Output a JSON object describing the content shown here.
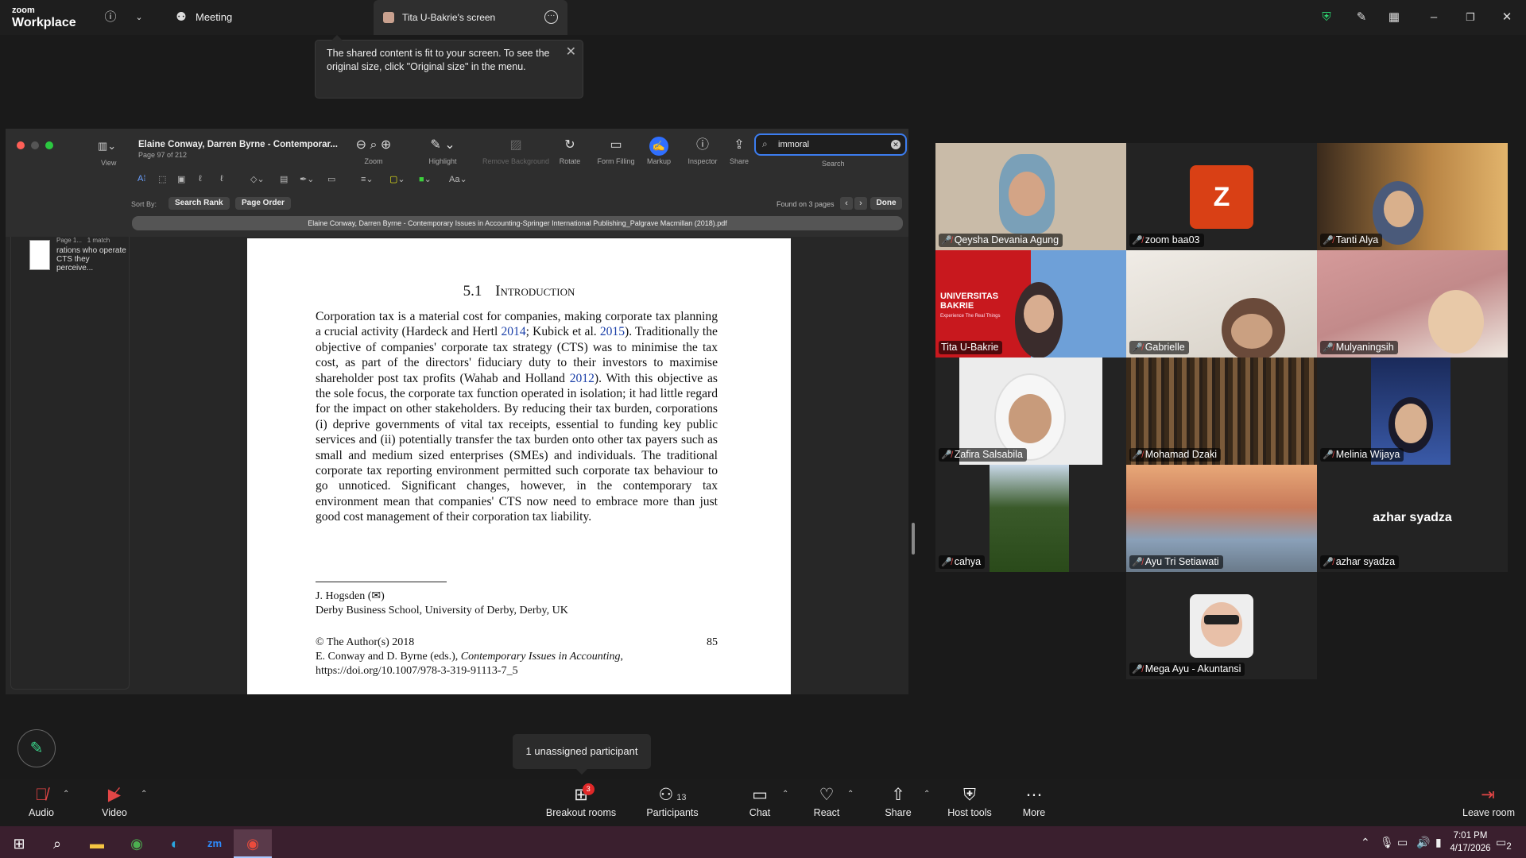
{
  "titlebar": {
    "brand_top": "zoom",
    "brand_bottom": "Workplace",
    "meeting_label": "Meeting",
    "share_tab_label": "Tita U-Bakrie's screen"
  },
  "tooltip": {
    "text": "The shared content is fit to your screen. To see the original size, click \"Original size\" in the menu."
  },
  "pdf": {
    "view_label": "View",
    "doc_title": "Elaine Conway, Darren Byrne - Contemporar...",
    "page_info": "Page 97 of 212",
    "tools": {
      "zoom": "Zoom",
      "highlight": "Highlight",
      "remove_background": "Remove Background",
      "rotate": "Rotate",
      "form_filling": "Form Filling",
      "markup": "Markup",
      "inspector": "Inspector",
      "share": "Share",
      "search": "Search"
    },
    "search_value": "immoral",
    "font_control": "Aa",
    "sort_by": "Sort By:",
    "sort_rank": "Search Rank",
    "sort_order": "Page Order",
    "found": "Found on 3 pages",
    "done": "Done",
    "filename": "Elaine Conway, Darren Byrne - Contemporary Issues in Accounting-Springer International Publishing_Palgrave Macmillan (2018).pdf",
    "thumb": {
      "page": "Page 1...",
      "match": "1 match",
      "snippet": "rations who operate CTS they perceive..."
    },
    "page": {
      "section_num": "5.1",
      "section_title": "Introduction",
      "p1": "Corporation tax is a material cost for companies, making corporate tax planning a crucial activity (Hardeck and Hertl ",
      "c1": "2014",
      "p2": "; Kubick et al. ",
      "c2": "2015",
      "p3": "). Traditionally the objective of companies' corporate tax strategy (CTS) was to minimise the tax cost, as part of the directors' fiduciary duty to their investors to maximise shareholder post tax profits (Wahab and Holland ",
      "c3": "2012",
      "p4": "). With this objective as the sole focus, the corporate tax function operated in isolation; it had little regard for the impact on other stakeholders. By reducing their tax burden, corporations (i) deprive governments of vital tax receipts, essential to funding key public services and (ii) potentially transfer the tax burden onto other tax payers such as small and medium sized enterprises (SMEs) and individuals. The traditional corporate tax reporting environment permitted such corporate tax behaviour to go unnoticed. Significant changes, however, in the contemporary tax environment mean that companies' CTS now need to embrace more than just good cost management of their corporation tax liability.",
      "author": "J. Hogsden (✉)",
      "affiliation": "Derby Business School, University of Derby, Derby, UK",
      "copyright": "© The Author(s) 2018",
      "editors_prefix": "E. Conway and D. Byrne (eds.), ",
      "book_title": "Contemporary Issues in Accounting",
      "editors_suffix": ",",
      "doi": "https://doi.org/10.1007/978-3-319-91113-7_5",
      "page_number": "85"
    }
  },
  "participants": [
    {
      "name": "Qeysha Devania Agung"
    },
    {
      "name": "zoom baa03",
      "initial": "Z"
    },
    {
      "name": "Tanti Alya"
    },
    {
      "name": "Tita U-Bakrie",
      "banner_title": "UNIVERSITAS BAKRIE",
      "banner_sub": "Experience The Real Things"
    },
    {
      "name": "Gabrielle"
    },
    {
      "name": "Mulyaningsih"
    },
    {
      "name": "Zafira Salsabila"
    },
    {
      "name": "Mohamad Dzaki"
    },
    {
      "name": "Melinia Wijaya"
    },
    {
      "name": "cahya"
    },
    {
      "name": "Ayu Tri Setiawati"
    },
    {
      "name": "azhar syadza",
      "big": "azhar syadza"
    },
    {
      "name": "Mega Ayu - Akuntansi"
    }
  ],
  "breakout_tooltip": "1 unassigned participant",
  "controls": {
    "audio": "Audio",
    "video": "Video",
    "breakout": "Breakout rooms",
    "breakout_badge": "3",
    "participants": "Participants",
    "participants_count": "13",
    "chat": "Chat",
    "react": "React",
    "share": "Share",
    "host_tools": "Host tools",
    "more": "More",
    "leave": "Leave room"
  },
  "taskbar": {
    "time": "7:01 PM",
    "date": "4/17/2026",
    "notifications": "2"
  },
  "colors": {
    "active_speaker": "#2dd36f",
    "accent": "#2f6fff",
    "mic_muted": "#e34646",
    "taskbar": "#3a1f2e"
  }
}
